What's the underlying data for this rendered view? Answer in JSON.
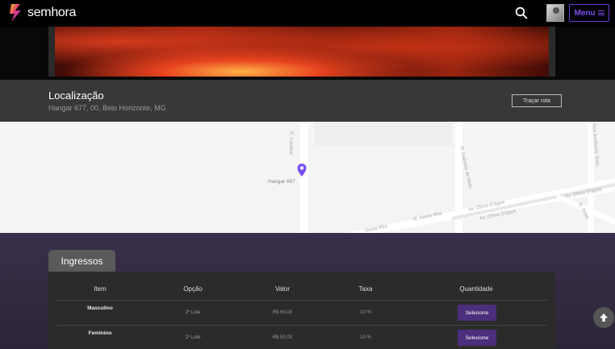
{
  "header": {
    "brand": "semhora",
    "menu_label": "Menu",
    "colors": {
      "accent": "#7b4ef0"
    }
  },
  "location": {
    "title": "Localização",
    "address": "Hangar 677, 00, Belo Horizonte, MG",
    "route_button": "Traçar rota"
  },
  "map": {
    "pin_label": "Hangar 667",
    "streets": [
      "R. Cardeal",
      "R. Gabriela de Melo",
      "Av. Olhos D'água",
      "Av. Olhos D'água",
      "Av. Olhos D'água",
      "R. Santa Rita",
      "Santa Rita",
      "Rua Adalberto Tedo",
      "R. Rosa"
    ]
  },
  "tickets": {
    "tab_label": "Ingressos",
    "columns": [
      "Item",
      "Opção",
      "Valor",
      "Taxa",
      "Quantidade"
    ],
    "rows": [
      {
        "item": "Masculino",
        "option": "2º Lote",
        "value": "R$ 60,00",
        "fee": "10 %",
        "action": "Selecione"
      },
      {
        "item": "Feminino",
        "option": "2º Lote",
        "value": "R$ 50,00",
        "fee": "10 %",
        "action": "Selecione"
      }
    ]
  },
  "icons": [
    "logo-icon",
    "search-icon",
    "avatar",
    "menu-icon",
    "map-pin-icon",
    "arrow-up-icon"
  ]
}
